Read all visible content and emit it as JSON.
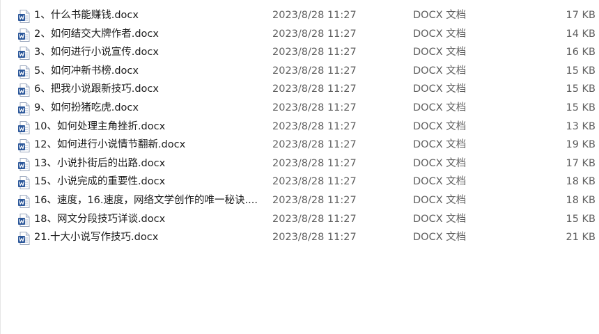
{
  "files": [
    {
      "name": "1、什么书能赚钱.docx",
      "modified": "2023/8/28 11:27",
      "type": "DOCX 文档",
      "size": "17 KB",
      "icon": "word-document-icon"
    },
    {
      "name": "2、如何结交大牌作者.docx",
      "modified": "2023/8/28 11:27",
      "type": "DOCX 文档",
      "size": "14 KB",
      "icon": "word-document-icon"
    },
    {
      "name": "3、如何进行小说宣传.docx",
      "modified": "2023/8/28 11:27",
      "type": "DOCX 文档",
      "size": "16 KB",
      "icon": "word-document-icon"
    },
    {
      "name": "5、如何冲新书榜.docx",
      "modified": "2023/8/28 11:27",
      "type": "DOCX 文档",
      "size": "15 KB",
      "icon": "word-document-icon"
    },
    {
      "name": "6、把我小说跟新技巧.docx",
      "modified": "2023/8/28 11:27",
      "type": "DOCX 文档",
      "size": "15 KB",
      "icon": "word-document-icon"
    },
    {
      "name": "9、如何扮猪吃虎.docx",
      "modified": "2023/8/28 11:27",
      "type": "DOCX 文档",
      "size": "15 KB",
      "icon": "word-document-icon"
    },
    {
      "name": "10、如何处理主角挫折.docx",
      "modified": "2023/8/28 11:27",
      "type": "DOCX 文档",
      "size": "13 KB",
      "icon": "word-document-icon"
    },
    {
      "name": "12、如何进行小说情节翻新.docx",
      "modified": "2023/8/28 11:27",
      "type": "DOCX 文档",
      "size": "19 KB",
      "icon": "word-document-icon"
    },
    {
      "name": "13、小说扑街后的出路.docx",
      "modified": "2023/8/28 11:27",
      "type": "DOCX 文档",
      "size": "17 KB",
      "icon": "word-document-icon"
    },
    {
      "name": "15、小说完成的重要性.docx",
      "modified": "2023/8/28 11:27",
      "type": "DOCX 文档",
      "size": "18 KB",
      "icon": "word-document-icon"
    },
    {
      "name": "16、速度，16.速度，网络文学创作的唯一秘诀....",
      "modified": "2023/8/28 11:27",
      "type": "DOCX 文档",
      "size": "18 KB",
      "icon": "word-document-icon"
    },
    {
      "name": "18、网文分段技巧详谈.docx",
      "modified": "2023/8/28 11:27",
      "type": "DOCX 文档",
      "size": "15 KB",
      "icon": "word-document-icon"
    },
    {
      "name": "21.十大小说写作技巧.docx",
      "modified": "2023/8/28 11:27",
      "type": "DOCX 文档",
      "size": "21 KB",
      "icon": "word-document-icon"
    }
  ],
  "colors": {
    "word_blue": "#2b579a",
    "word_blue_light": "#4a7fd4",
    "text_primary": "#1b1b1b",
    "text_secondary": "#5f5f5f"
  }
}
